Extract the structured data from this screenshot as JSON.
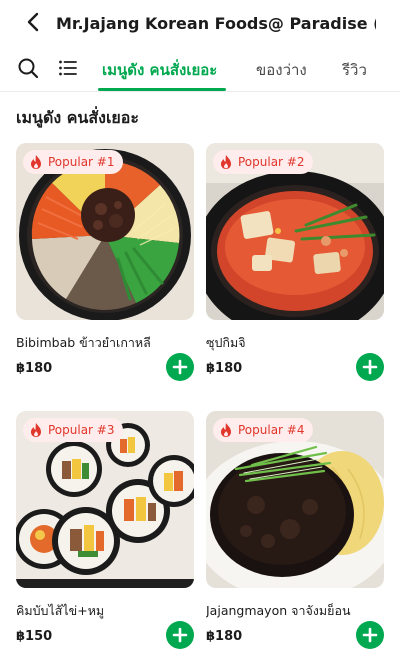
{
  "header": {
    "store_title": "Mr.Jajang Korean Foods@ Paradise (มิ..."
  },
  "tabs": [
    {
      "label": "เมนูดัง คนสั่งเยอะ",
      "active": true
    },
    {
      "label": "ของว่าง",
      "active": false
    },
    {
      "label": "รีวิว",
      "active": false
    }
  ],
  "section": {
    "title": "เมนูดัง คนสั่งเยอะ"
  },
  "items": [
    {
      "badge": "Popular #1",
      "name": "Bibimbab ข้าวยำเกาหลี",
      "price": "฿180"
    },
    {
      "badge": "Popular #2",
      "name": "ซุปกิมจิ",
      "price": "฿180"
    },
    {
      "badge": "Popular #3",
      "name": "คิมบับไส้ไข่+หมู",
      "price": "฿150"
    },
    {
      "badge": "Popular #4",
      "name": "Jajangmayon จาจังมย็อน",
      "price": "฿180"
    }
  ],
  "colors": {
    "accent": "#00a84f",
    "badge_bg": "#ffecec",
    "badge_text": "#e0362b"
  },
  "icons": {
    "back": "back-arrow-icon",
    "search": "search-icon",
    "list": "list-icon",
    "badge": "fire-icon",
    "add": "plus-icon"
  }
}
